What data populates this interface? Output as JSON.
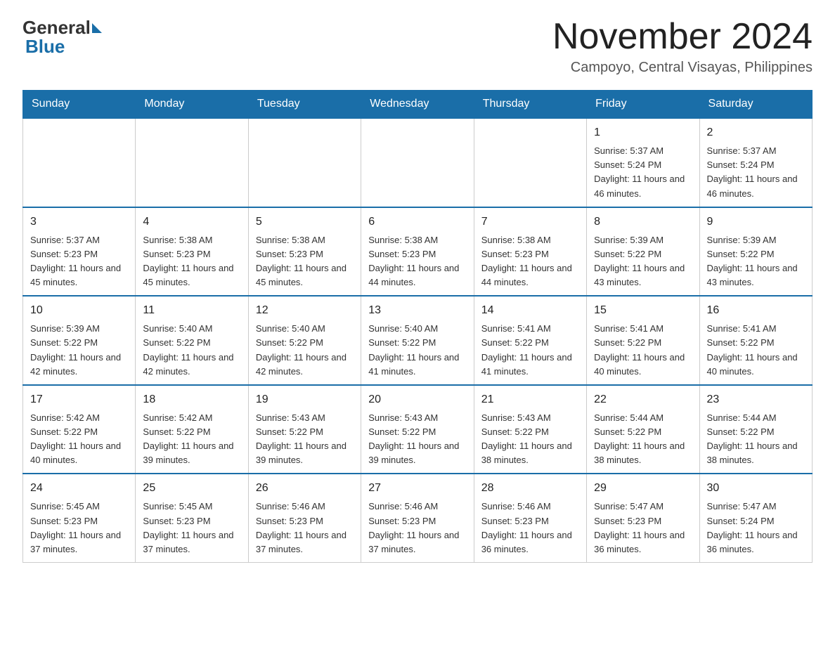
{
  "header": {
    "logo_general": "General",
    "logo_blue": "Blue",
    "month_year": "November 2024",
    "location": "Campoyo, Central Visayas, Philippines"
  },
  "days_of_week": [
    "Sunday",
    "Monday",
    "Tuesday",
    "Wednesday",
    "Thursday",
    "Friday",
    "Saturday"
  ],
  "weeks": [
    [
      {
        "day": "",
        "info": ""
      },
      {
        "day": "",
        "info": ""
      },
      {
        "day": "",
        "info": ""
      },
      {
        "day": "",
        "info": ""
      },
      {
        "day": "",
        "info": ""
      },
      {
        "day": "1",
        "info": "Sunrise: 5:37 AM\nSunset: 5:24 PM\nDaylight: 11 hours and 46 minutes."
      },
      {
        "day": "2",
        "info": "Sunrise: 5:37 AM\nSunset: 5:24 PM\nDaylight: 11 hours and 46 minutes."
      }
    ],
    [
      {
        "day": "3",
        "info": "Sunrise: 5:37 AM\nSunset: 5:23 PM\nDaylight: 11 hours and 45 minutes."
      },
      {
        "day": "4",
        "info": "Sunrise: 5:38 AM\nSunset: 5:23 PM\nDaylight: 11 hours and 45 minutes."
      },
      {
        "day": "5",
        "info": "Sunrise: 5:38 AM\nSunset: 5:23 PM\nDaylight: 11 hours and 45 minutes."
      },
      {
        "day": "6",
        "info": "Sunrise: 5:38 AM\nSunset: 5:23 PM\nDaylight: 11 hours and 44 minutes."
      },
      {
        "day": "7",
        "info": "Sunrise: 5:38 AM\nSunset: 5:23 PM\nDaylight: 11 hours and 44 minutes."
      },
      {
        "day": "8",
        "info": "Sunrise: 5:39 AM\nSunset: 5:22 PM\nDaylight: 11 hours and 43 minutes."
      },
      {
        "day": "9",
        "info": "Sunrise: 5:39 AM\nSunset: 5:22 PM\nDaylight: 11 hours and 43 minutes."
      }
    ],
    [
      {
        "day": "10",
        "info": "Sunrise: 5:39 AM\nSunset: 5:22 PM\nDaylight: 11 hours and 42 minutes."
      },
      {
        "day": "11",
        "info": "Sunrise: 5:40 AM\nSunset: 5:22 PM\nDaylight: 11 hours and 42 minutes."
      },
      {
        "day": "12",
        "info": "Sunrise: 5:40 AM\nSunset: 5:22 PM\nDaylight: 11 hours and 42 minutes."
      },
      {
        "day": "13",
        "info": "Sunrise: 5:40 AM\nSunset: 5:22 PM\nDaylight: 11 hours and 41 minutes."
      },
      {
        "day": "14",
        "info": "Sunrise: 5:41 AM\nSunset: 5:22 PM\nDaylight: 11 hours and 41 minutes."
      },
      {
        "day": "15",
        "info": "Sunrise: 5:41 AM\nSunset: 5:22 PM\nDaylight: 11 hours and 40 minutes."
      },
      {
        "day": "16",
        "info": "Sunrise: 5:41 AM\nSunset: 5:22 PM\nDaylight: 11 hours and 40 minutes."
      }
    ],
    [
      {
        "day": "17",
        "info": "Sunrise: 5:42 AM\nSunset: 5:22 PM\nDaylight: 11 hours and 40 minutes."
      },
      {
        "day": "18",
        "info": "Sunrise: 5:42 AM\nSunset: 5:22 PM\nDaylight: 11 hours and 39 minutes."
      },
      {
        "day": "19",
        "info": "Sunrise: 5:43 AM\nSunset: 5:22 PM\nDaylight: 11 hours and 39 minutes."
      },
      {
        "day": "20",
        "info": "Sunrise: 5:43 AM\nSunset: 5:22 PM\nDaylight: 11 hours and 39 minutes."
      },
      {
        "day": "21",
        "info": "Sunrise: 5:43 AM\nSunset: 5:22 PM\nDaylight: 11 hours and 38 minutes."
      },
      {
        "day": "22",
        "info": "Sunrise: 5:44 AM\nSunset: 5:22 PM\nDaylight: 11 hours and 38 minutes."
      },
      {
        "day": "23",
        "info": "Sunrise: 5:44 AM\nSunset: 5:22 PM\nDaylight: 11 hours and 38 minutes."
      }
    ],
    [
      {
        "day": "24",
        "info": "Sunrise: 5:45 AM\nSunset: 5:23 PM\nDaylight: 11 hours and 37 minutes."
      },
      {
        "day": "25",
        "info": "Sunrise: 5:45 AM\nSunset: 5:23 PM\nDaylight: 11 hours and 37 minutes."
      },
      {
        "day": "26",
        "info": "Sunrise: 5:46 AM\nSunset: 5:23 PM\nDaylight: 11 hours and 37 minutes."
      },
      {
        "day": "27",
        "info": "Sunrise: 5:46 AM\nSunset: 5:23 PM\nDaylight: 11 hours and 37 minutes."
      },
      {
        "day": "28",
        "info": "Sunrise: 5:46 AM\nSunset: 5:23 PM\nDaylight: 11 hours and 36 minutes."
      },
      {
        "day": "29",
        "info": "Sunrise: 5:47 AM\nSunset: 5:23 PM\nDaylight: 11 hours and 36 minutes."
      },
      {
        "day": "30",
        "info": "Sunrise: 5:47 AM\nSunset: 5:24 PM\nDaylight: 11 hours and 36 minutes."
      }
    ]
  ]
}
